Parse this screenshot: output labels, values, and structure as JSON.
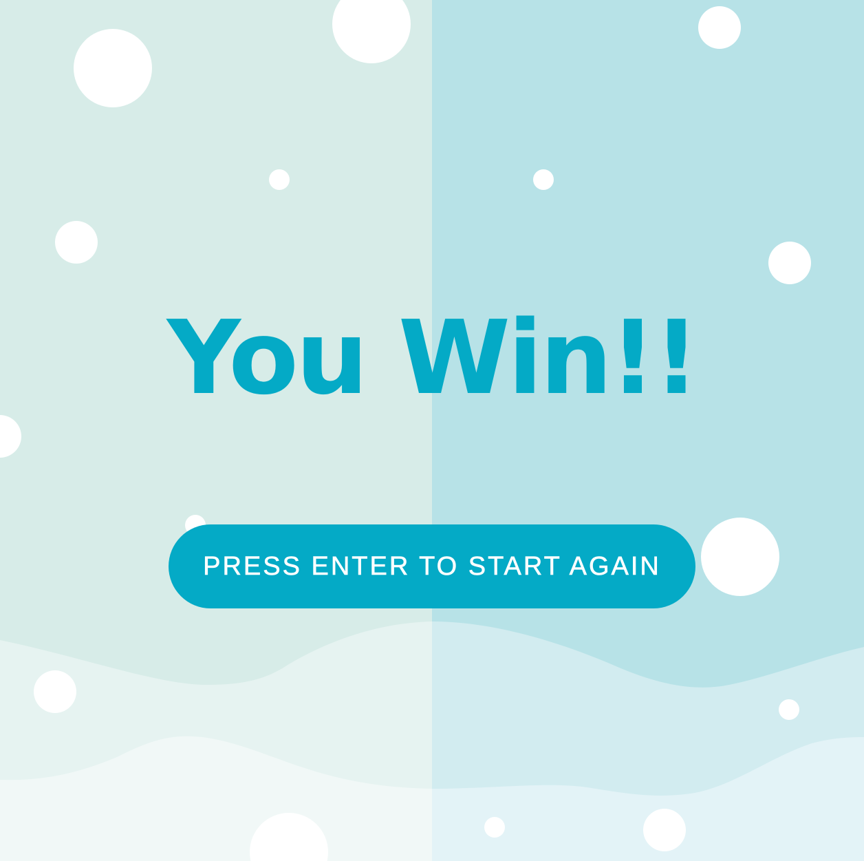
{
  "screen": {
    "title": "You Win!!",
    "restart_button_label": "PRESS ENTER TO START AGAIN"
  },
  "colors": {
    "accent": "#04aac6",
    "button_text": "#ffffff",
    "bg_left": "#d7ece8",
    "bg_right": "#b7e2e7",
    "hill_mid_left": "#e6f3f1",
    "hill_mid_right": "#d2ecf0",
    "hill_front_left": "#f1f8f7",
    "hill_front_right": "#e3f3f7",
    "snow": "#ffffff"
  }
}
